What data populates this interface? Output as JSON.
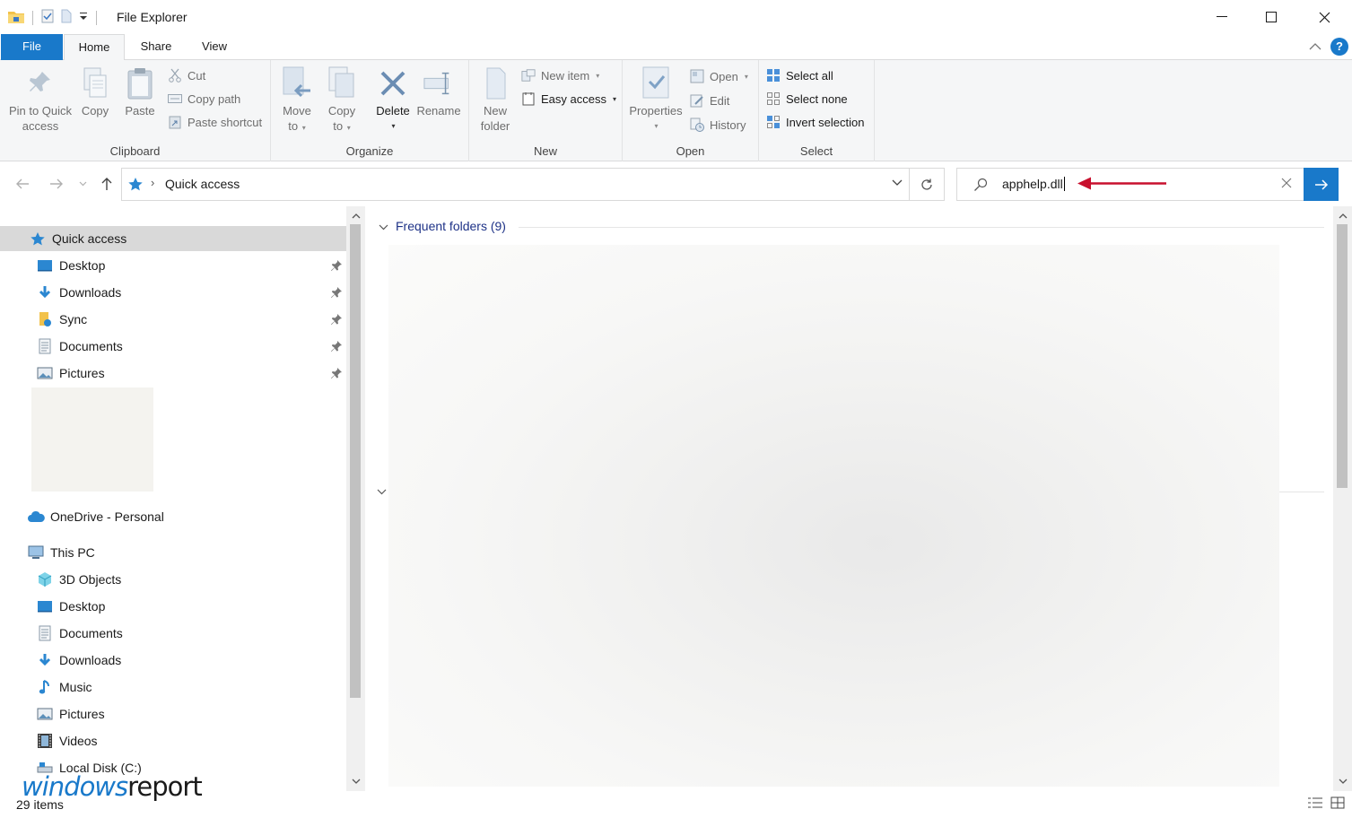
{
  "window": {
    "title": "File Explorer"
  },
  "ribbon_tabs": {
    "file": "File",
    "home": "Home",
    "share": "Share",
    "view": "View"
  },
  "clipboard": {
    "pin_line1": "Pin to Quick",
    "pin_line2": "access",
    "copy": "Copy",
    "paste": "Paste",
    "cut": "Cut",
    "copy_path": "Copy path",
    "paste_shortcut": "Paste shortcut",
    "group": "Clipboard"
  },
  "organize": {
    "move_line1": "Move",
    "move_line2": "to",
    "copy_line1": "Copy",
    "copy_line2": "to",
    "delete": "Delete",
    "rename": "Rename",
    "group": "Organize"
  },
  "new_group": {
    "new_folder_line1": "New",
    "new_folder_line2": "folder",
    "new_item": "New item",
    "easy_access": "Easy access",
    "group": "New"
  },
  "open_group": {
    "properties": "Properties",
    "open": "Open",
    "edit": "Edit",
    "history": "History",
    "group": "Open"
  },
  "select_group": {
    "select_all": "Select all",
    "select_none": "Select none",
    "invert": "Invert selection",
    "group": "Select"
  },
  "address": {
    "crumb": "Quick access"
  },
  "search": {
    "value": "apphelp.dll"
  },
  "nav": {
    "quick_access": "Quick access",
    "qa_items": [
      "Desktop",
      "Downloads",
      "Sync",
      "Documents",
      "Pictures"
    ],
    "onedrive": "OneDrive - Personal",
    "this_pc": "This PC",
    "pc_items": [
      "3D Objects",
      "Desktop",
      "Documents",
      "Downloads",
      "Music",
      "Pictures",
      "Videos",
      "Local Disk (C:)"
    ]
  },
  "content": {
    "section": "Frequent folders (9)"
  },
  "status": {
    "count": "29 items"
  },
  "watermark": {
    "part1": "windows",
    "part2": "report"
  },
  "colors": {
    "accent": "#1979ca",
    "annotation_arrow": "#c8102e"
  }
}
